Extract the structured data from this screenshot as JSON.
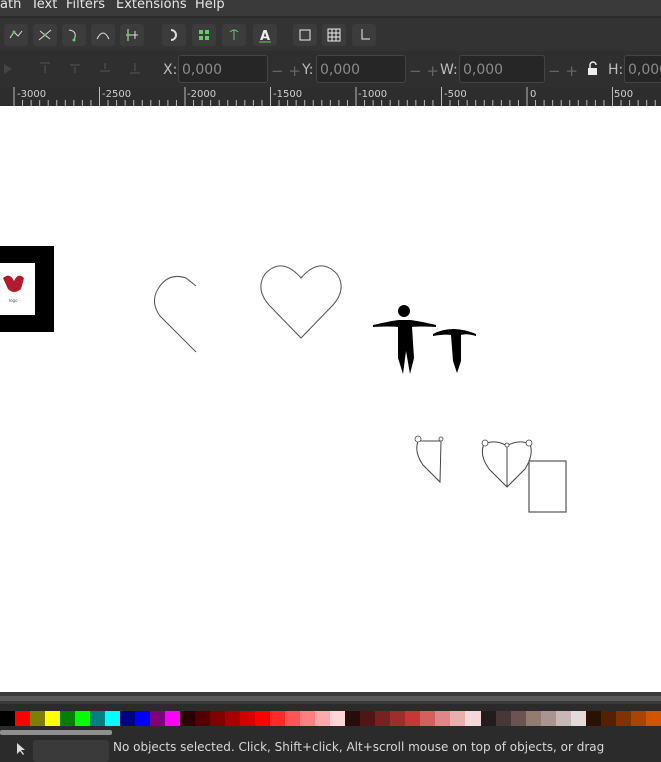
{
  "menubar": {
    "path": "ath",
    "text": "Text",
    "filters": "Filters",
    "extensions": "Extensions",
    "help": "Help"
  },
  "coords": {
    "x_label": "X:",
    "x_value": "0,000",
    "y_label": "Y:",
    "y_value": "0,000",
    "w_label": "W:",
    "w_value": "0,000",
    "h_label": "H:",
    "h_value": "0,000"
  },
  "ruler": {
    "m3000": "-3000",
    "m2500": "-2500",
    "m2000": "-2000",
    "m1500": "-1500",
    "m1000": "-1000",
    "m500": "-500",
    "zero": "0",
    "p500": "500"
  },
  "status": {
    "message": "No objects selected. Click, Shift+click, Alt+scroll mouse on top of objects, or drag"
  },
  "palette_colors": [
    "#000000",
    "#ff0000",
    "#808000",
    "#ffff00",
    "#008000",
    "#00ff00",
    "#008080",
    "#00ffff",
    "#000080",
    "#0000ff",
    "#800080",
    "#ff00ff",
    "#2a0000",
    "#550000",
    "#800000",
    "#aa0000",
    "#d40000",
    "#ff0000",
    "#ff2a2a",
    "#ff5555",
    "#ff8080",
    "#ffaaaa",
    "#ffd5d5",
    "#280b0b",
    "#501616",
    "#782121",
    "#a02c2c",
    "#c83737",
    "#d35f5f",
    "#de8787",
    "#e9afaf",
    "#f4d7d7",
    "#241c1c",
    "#483737",
    "#6c5353",
    "#917c6f",
    "#ac9393",
    "#c8b7b7",
    "#e3dbdb",
    "#2b1100",
    "#552200",
    "#803300",
    "#aa4400",
    "#d45500"
  ]
}
